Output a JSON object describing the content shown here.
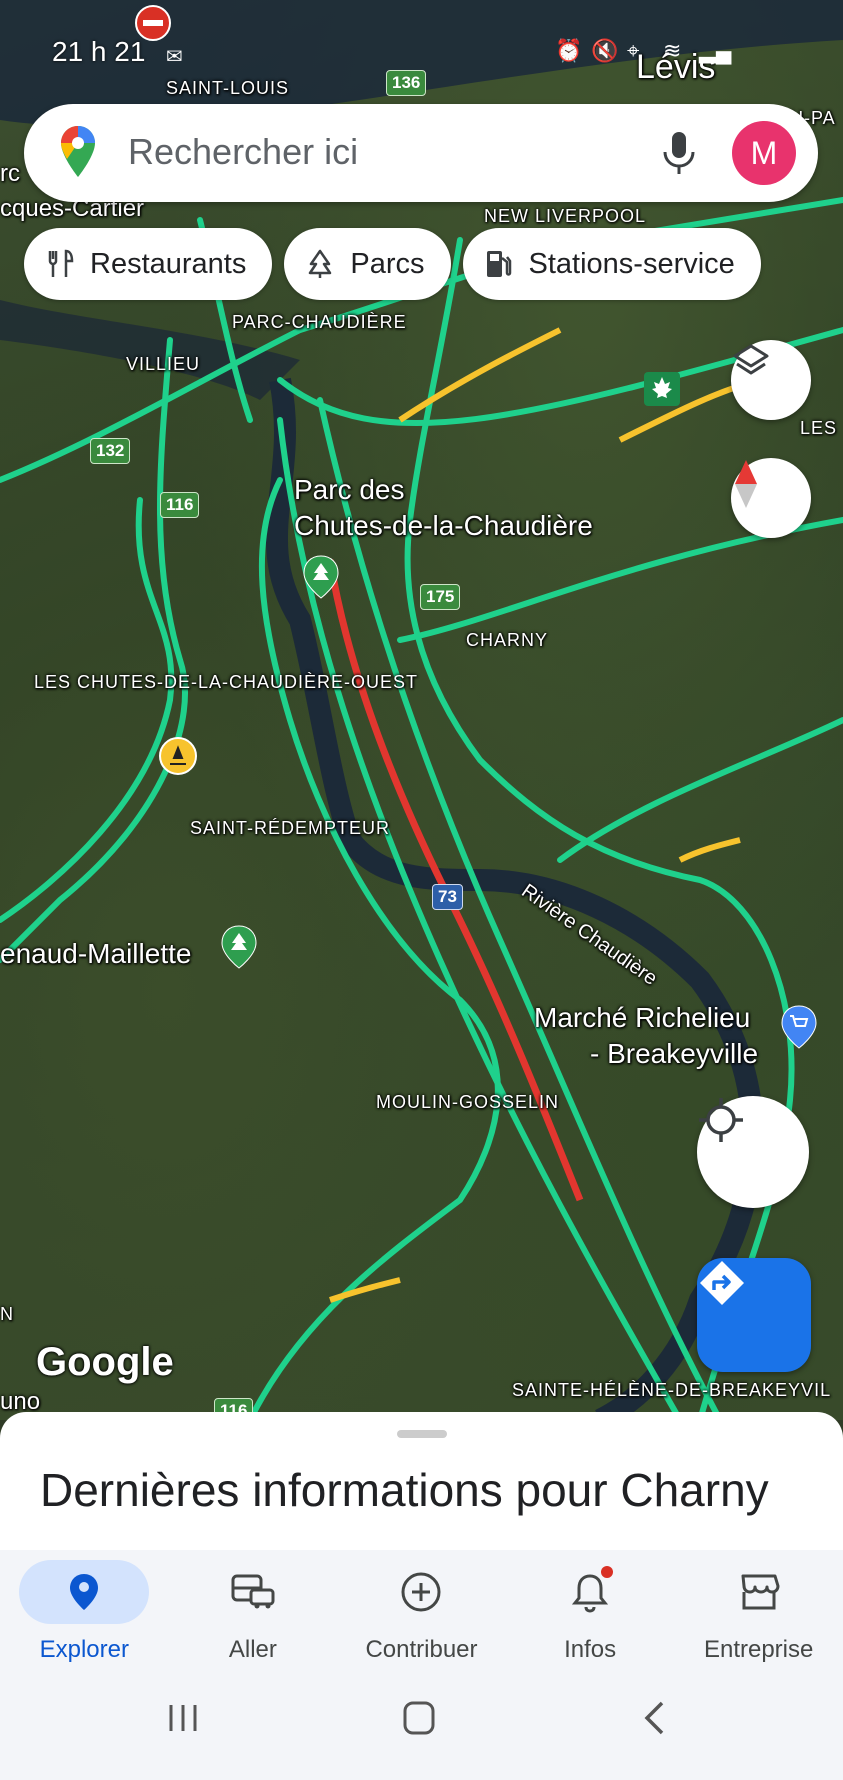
{
  "status_bar": {
    "time": "21 h 21"
  },
  "search": {
    "placeholder": "Rechercher ici",
    "avatar_letter": "M"
  },
  "chips": [
    {
      "label": "Restaurants",
      "icon": "restaurant-icon"
    },
    {
      "label": "Parcs",
      "icon": "park-icon"
    },
    {
      "label": "Stations-service",
      "icon": "gas-station-icon"
    }
  ],
  "map": {
    "labels": {
      "saint_louis": "SAINT-LOUIS",
      "levis": "Lévis",
      "new_liverpool": "NEW LIVERPOOL",
      "jacques_cartier": "cques-Cartier",
      "parc_c": "rc",
      "pa": "U-PA",
      "parc_chaudiere": "PARC-CHAUDIÈRE",
      "villieu": "VILLIEU",
      "les": "LES",
      "parc_des_chutes_1": "Parc des",
      "parc_des_chutes_2": "Chutes-de-la-Chaudière",
      "charny": "CHARNY",
      "chutes_ouest": "LES CHUTES-DE-LA-CHAUDIÈRE-OUEST",
      "saint_redempteur": "SAINT-RÉDEMPTEUR",
      "riviere_chaudiere": "Rivière Chaudière",
      "renaud_maillette": "enaud-Maillette",
      "marche_1": "Marché Richelieu",
      "marche_2": "- Breakeyville",
      "moulin_gosselin": "MOULIN-GOSSELIN",
      "sainte_helene": "SAINTE-HÉLÈNE-DE-BREAKEYVIL",
      "left_n": "N",
      "uno": "uno",
      "google": "Google"
    },
    "shields": {
      "r136": "136",
      "r132": "132",
      "r116": "116",
      "r175": "175",
      "a73": "73",
      "r116b": "116"
    }
  },
  "sheet": {
    "title": "Dernières informations pour Charny"
  },
  "bottom_nav": [
    {
      "label": "Explorer",
      "icon": "explore-pin-icon",
      "active": true
    },
    {
      "label": "Aller",
      "icon": "commute-icon",
      "active": false
    },
    {
      "label": "Contribuer",
      "icon": "add-circle-icon",
      "active": false
    },
    {
      "label": "Infos",
      "icon": "bell-icon",
      "active": false,
      "badge": true
    },
    {
      "label": "Entreprise",
      "icon": "storefront-icon",
      "active": false
    }
  ],
  "colors": {
    "accent": "#1a73e8",
    "traffic_green": "#1fd18c",
    "traffic_red": "#e2362f",
    "traffic_yellow": "#f7c32d",
    "avatar": "#e8336d"
  }
}
